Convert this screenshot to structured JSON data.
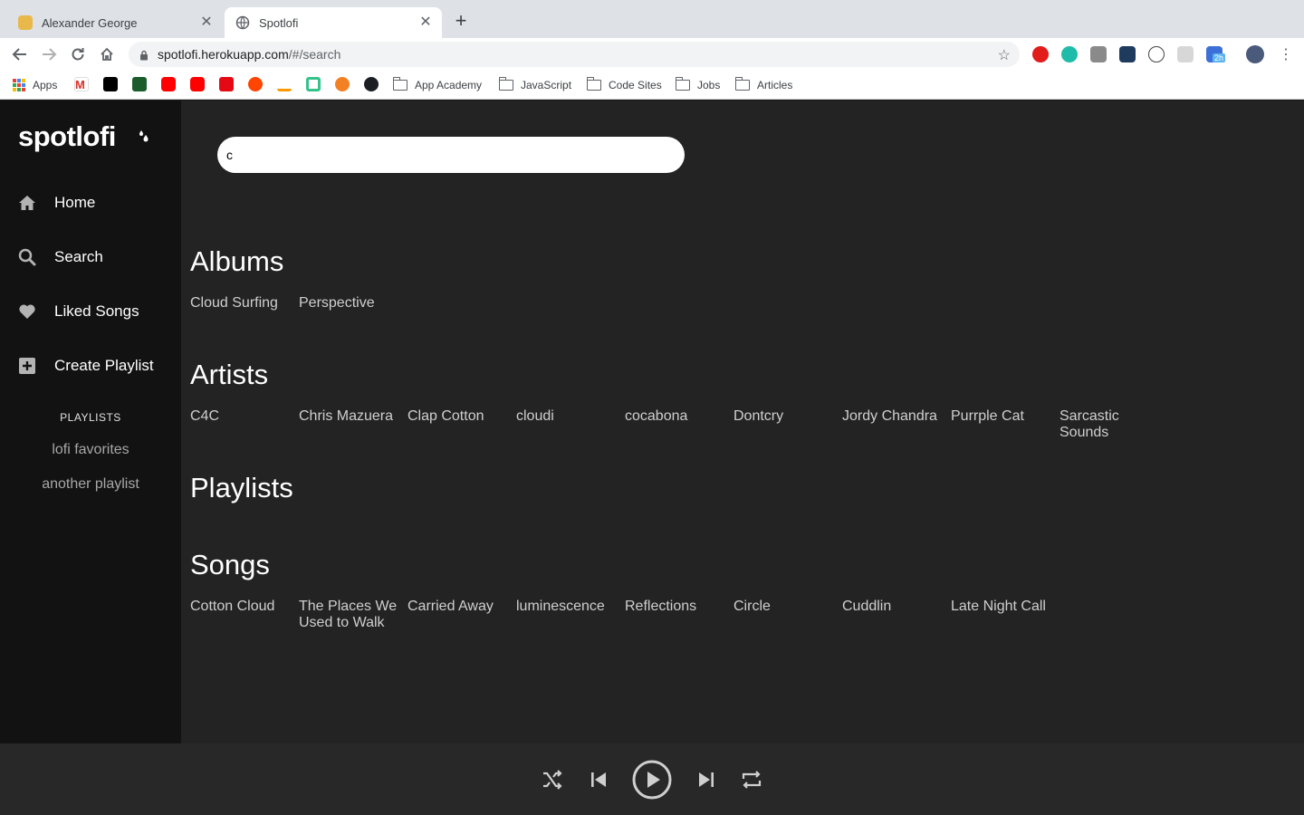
{
  "browser": {
    "tabs": [
      {
        "title": "Alexander George",
        "active": false
      },
      {
        "title": "Spotlofi",
        "active": true
      }
    ],
    "url_host": "spotlofi.herokuapp.com",
    "url_path": "/#/search",
    "bookmarks": {
      "apps_label": "Apps",
      "folders": [
        "App Academy",
        "JavaScript",
        "Code Sites",
        "Jobs",
        "Articles"
      ]
    },
    "extension_badge": "2h"
  },
  "app": {
    "logo": "spotlofi",
    "nav": [
      {
        "label": "Home",
        "icon": "home-icon"
      },
      {
        "label": "Search",
        "icon": "search-icon"
      },
      {
        "label": "Liked Songs",
        "icon": "heart-icon"
      },
      {
        "label": "Create Playlist",
        "icon": "plus-square-icon"
      }
    ],
    "playlists_heading": "PLAYLISTS",
    "playlists": [
      "lofi favorites",
      "another playlist"
    ],
    "search": {
      "value": "c",
      "placeholder": ""
    },
    "sections": {
      "albums": {
        "title": "Albums",
        "items": [
          "Cloud Surfing",
          "Perspective"
        ]
      },
      "artists": {
        "title": "Artists",
        "items": [
          "C4C",
          "Chris Mazuera",
          "Clap Cotton",
          "cloudi",
          "cocabona",
          "Dontcry",
          "Jordy Chandra",
          "Purrple Cat",
          "Sarcastic Sounds"
        ]
      },
      "playlists": {
        "title": "Playlists",
        "items": []
      },
      "songs": {
        "title": "Songs",
        "items": [
          "Cotton Cloud",
          "The Places We Used to Walk",
          "Carried Away",
          "luminescence",
          "Reflections",
          "Circle",
          "Cuddlin",
          "Late Night Call"
        ]
      }
    },
    "player": {
      "controls": [
        "shuffle-icon",
        "previous-icon",
        "play-icon",
        "next-icon",
        "repeat-icon"
      ]
    }
  },
  "colors": {
    "sidebar": "#121212",
    "main": "#232323",
    "player": "#282828",
    "accent": "#ffffff"
  }
}
